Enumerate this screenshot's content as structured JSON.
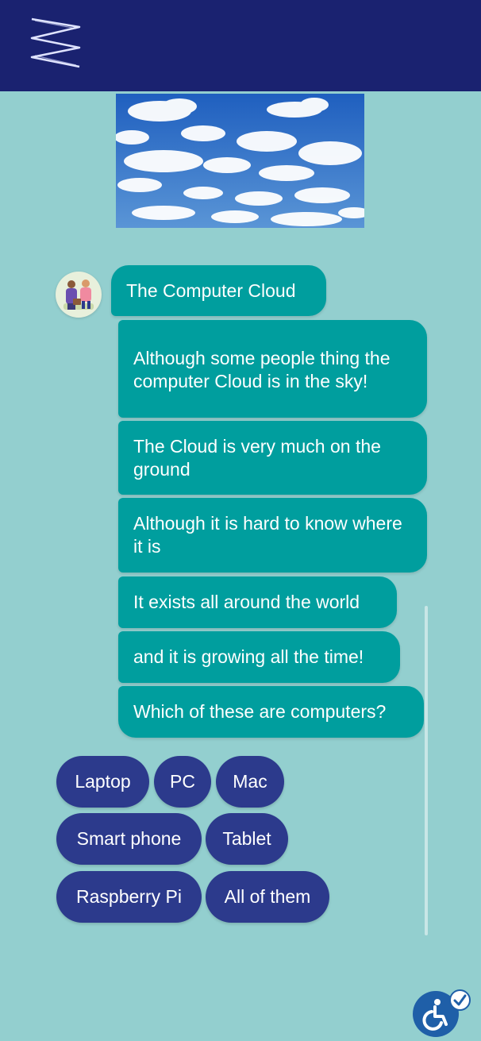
{
  "header": {
    "logo_icon": "zigzag-logo-icon",
    "background": "#1a2270"
  },
  "hero": {
    "image": "cloudy-sky-image"
  },
  "chat": {
    "avatar": "bot-avatar",
    "messages": [
      "The Computer Cloud",
      "Although some people thing the computer Cloud is in the sky!",
      "The Cloud is very much on the ground",
      "Although it is hard to know where it is",
      "It exists all around the world",
      "and it is growing all the time!",
      "Which of these are computers?"
    ]
  },
  "options": [
    "Laptop",
    "PC",
    "Mac",
    "Smart phone",
    "Tablet",
    "Raspberry Pi",
    "All of them"
  ],
  "accessibility": {
    "icon": "accessibility-icon"
  },
  "colors": {
    "background": "#93cfcf",
    "bubble": "#009e9e",
    "chip": "#2c3a8c"
  }
}
